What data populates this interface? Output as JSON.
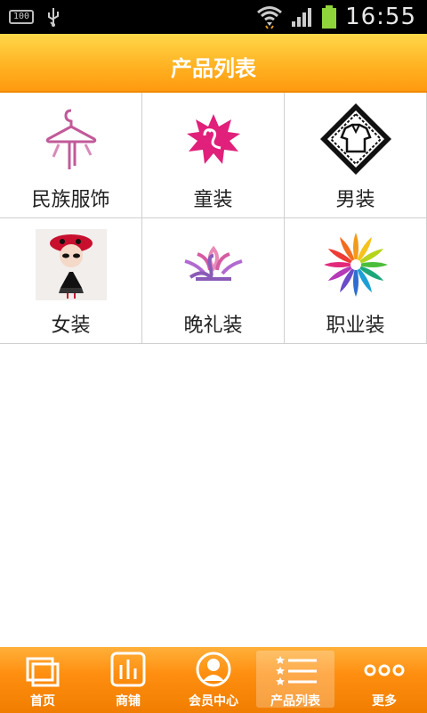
{
  "status_bar": {
    "battery_text": "100",
    "time": "16:55"
  },
  "header": {
    "title": "产品列表"
  },
  "categories": [
    {
      "label": "民族服饰",
      "icon": "hanger-icon"
    },
    {
      "label": "童装",
      "icon": "swan-flower-icon"
    },
    {
      "label": "男装",
      "icon": "shirt-stamp-icon"
    },
    {
      "label": "女装",
      "icon": "doll-icon"
    },
    {
      "label": "晚礼装",
      "icon": "lotus-swan-icon"
    },
    {
      "label": "职业装",
      "icon": "color-wheel-icon"
    }
  ],
  "tabs": [
    {
      "label": "首页",
      "icon": "home-icon"
    },
    {
      "label": "商铺",
      "icon": "shop-icon"
    },
    {
      "label": "会员中心",
      "icon": "member-icon"
    },
    {
      "label": "产品列表",
      "icon": "list-icon",
      "active": true
    },
    {
      "label": "更多",
      "icon": "more-icon"
    }
  ],
  "colors": {
    "accent": "#ff9a10",
    "pink": "#e0207a"
  }
}
